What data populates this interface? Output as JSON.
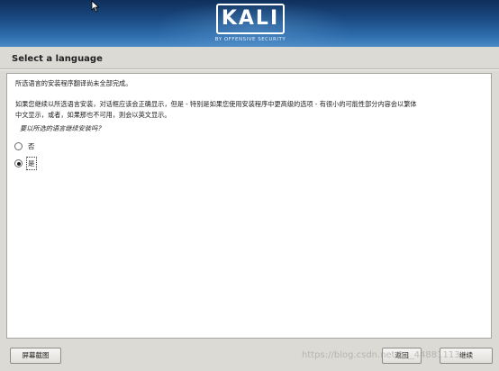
{
  "banner": {
    "logo_text": "KALI",
    "logo_subtitle": "BY OFFENSIVE SECURITY",
    "colors": {
      "top": "#0f2f5a",
      "bottom": "#4a8ac4"
    }
  },
  "page": {
    "title": "Select a language"
  },
  "content": {
    "para1": "所选语言的安装程序翻译尚未全部完成。",
    "para2_line1": "如果您继续以所选语言安装，对话框应该会正确显示，但是 - 特别是如果您使用安装程序中更高级的选项 - 有很小的可能性部分内容会以繁体",
    "para2_line2": "中文显示，或者，如果那也不可用，则会以英文显示。",
    "question": "要以所选的语言继续安装吗？",
    "options": [
      {
        "label": "否",
        "selected": false
      },
      {
        "label": "是",
        "selected": true
      }
    ]
  },
  "buttons": {
    "screenshot": "屏幕截图",
    "back": "返回",
    "continue": "继续"
  },
  "watermark": "https://blog.csdn.net/qq_44881113"
}
